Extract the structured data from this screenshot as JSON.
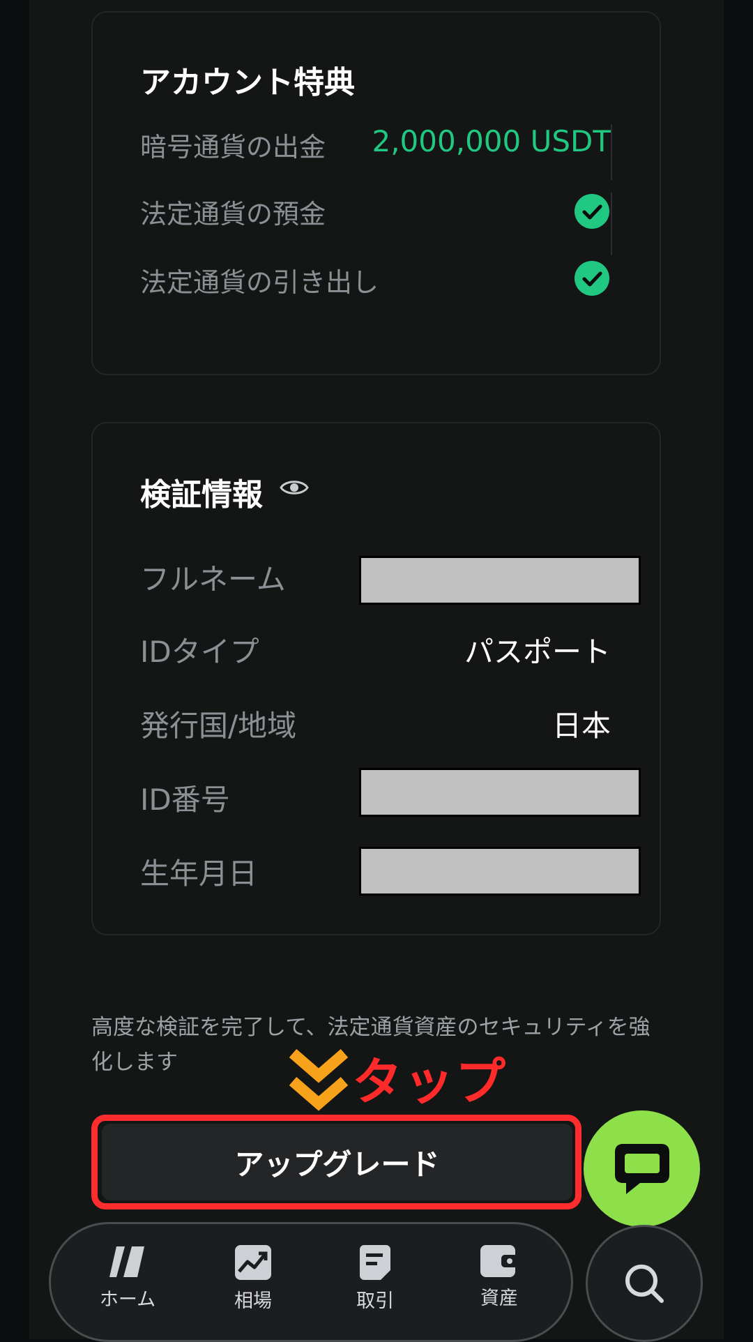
{
  "benefits": {
    "title": "アカウント特典",
    "rows": [
      {
        "label": "暗号通貨の出金",
        "value": "2,000,000 USDT"
      },
      {
        "label": "法定通貨の預金",
        "icon": "check-circle-icon"
      },
      {
        "label": "法定通貨の引き出し",
        "icon": "check-circle-icon"
      }
    ]
  },
  "verification": {
    "title": "検証情報",
    "eye_icon": "eye-icon",
    "rows": [
      {
        "label": "フルネーム",
        "redacted": true
      },
      {
        "label": "IDタイプ",
        "value": "パスポート"
      },
      {
        "label": "発行国/地域",
        "value": "日本"
      },
      {
        "label": "ID番号",
        "redacted": true
      },
      {
        "label": "生年月日",
        "redacted": true
      }
    ]
  },
  "note": "高度な検証を完了して、法定通貨資産のセキュリティを強化します",
  "annotation": {
    "tap_label": "タップ"
  },
  "upgrade_button": {
    "label": "アップグレード"
  },
  "chat_button": {
    "icon": "chat-bubble-icon"
  },
  "nav": {
    "items": [
      {
        "label": "ホーム",
        "icon": "home-icon"
      },
      {
        "label": "相場",
        "icon": "chart-icon"
      },
      {
        "label": "取引",
        "icon": "trade-icon"
      },
      {
        "label": "資産",
        "icon": "wallet-icon"
      }
    ],
    "search_icon": "search-icon"
  },
  "colors": {
    "accent_green": "#21c882",
    "chat_green": "#8ee04a",
    "annotation_red": "#ff2a2a",
    "annotation_orange": "#f7a21b"
  }
}
